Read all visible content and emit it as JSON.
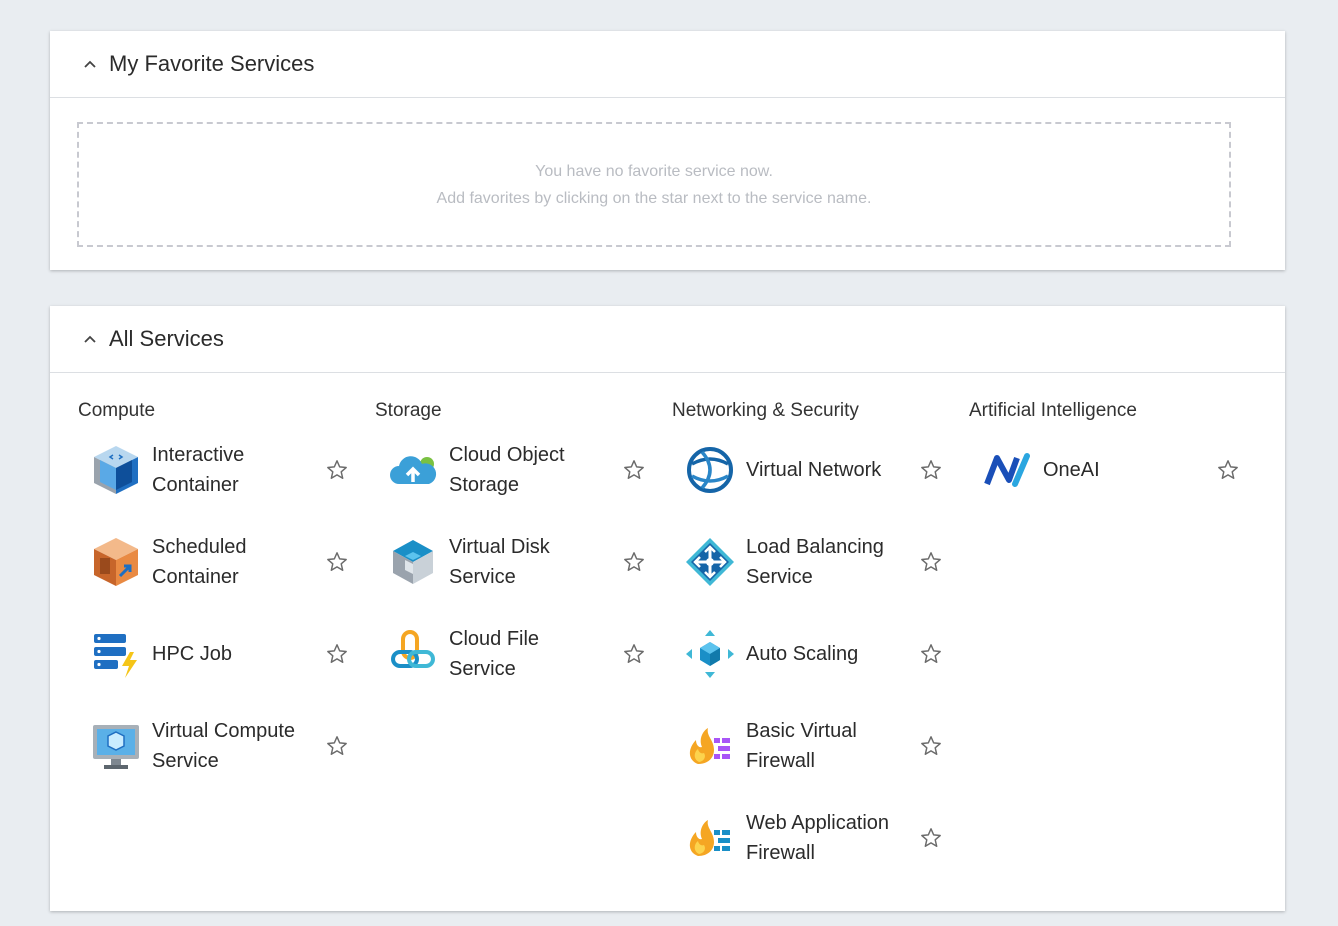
{
  "favorites": {
    "title": "My Favorite Services",
    "empty_line1": "You have no favorite service now.",
    "empty_line2": "Add favorites by clicking on the star next to the service name."
  },
  "all_services": {
    "title": "All Services",
    "categories": [
      {
        "name": "Compute",
        "items": [
          {
            "label": "Interactive Container",
            "icon": "interactive-container-icon"
          },
          {
            "label": "Scheduled Container",
            "icon": "scheduled-container-icon"
          },
          {
            "label": "HPC Job",
            "icon": "hpc-job-icon"
          },
          {
            "label": "Virtual Compute Service",
            "icon": "virtual-compute-icon"
          }
        ]
      },
      {
        "name": "Storage",
        "items": [
          {
            "label": "Cloud Object Storage",
            "icon": "cloud-upload-icon"
          },
          {
            "label": "Virtual Disk Service",
            "icon": "virtual-disk-icon"
          },
          {
            "label": "Cloud File Service",
            "icon": "cloud-file-link-icon"
          }
        ]
      },
      {
        "name": "Networking & Security",
        "items": [
          {
            "label": "Virtual Network",
            "icon": "virtual-network-globe-icon"
          },
          {
            "label": "Load Balancing Service",
            "icon": "load-balancer-icon"
          },
          {
            "label": "Auto Scaling",
            "icon": "auto-scaling-icon"
          },
          {
            "label": "Basic Virtual Firewall",
            "icon": "firewall-purple-icon"
          },
          {
            "label": "Web Application Firewall",
            "icon": "firewall-blue-icon"
          }
        ]
      },
      {
        "name": "Artificial Intelligence",
        "items": [
          {
            "label": "OneAI",
            "icon": "oneai-logo-icon"
          }
        ]
      }
    ]
  },
  "colors": {
    "background": "#e9edf1",
    "card": "#ffffff",
    "star": "#6b6b6b",
    "empty_text": "#b9bcc2"
  }
}
